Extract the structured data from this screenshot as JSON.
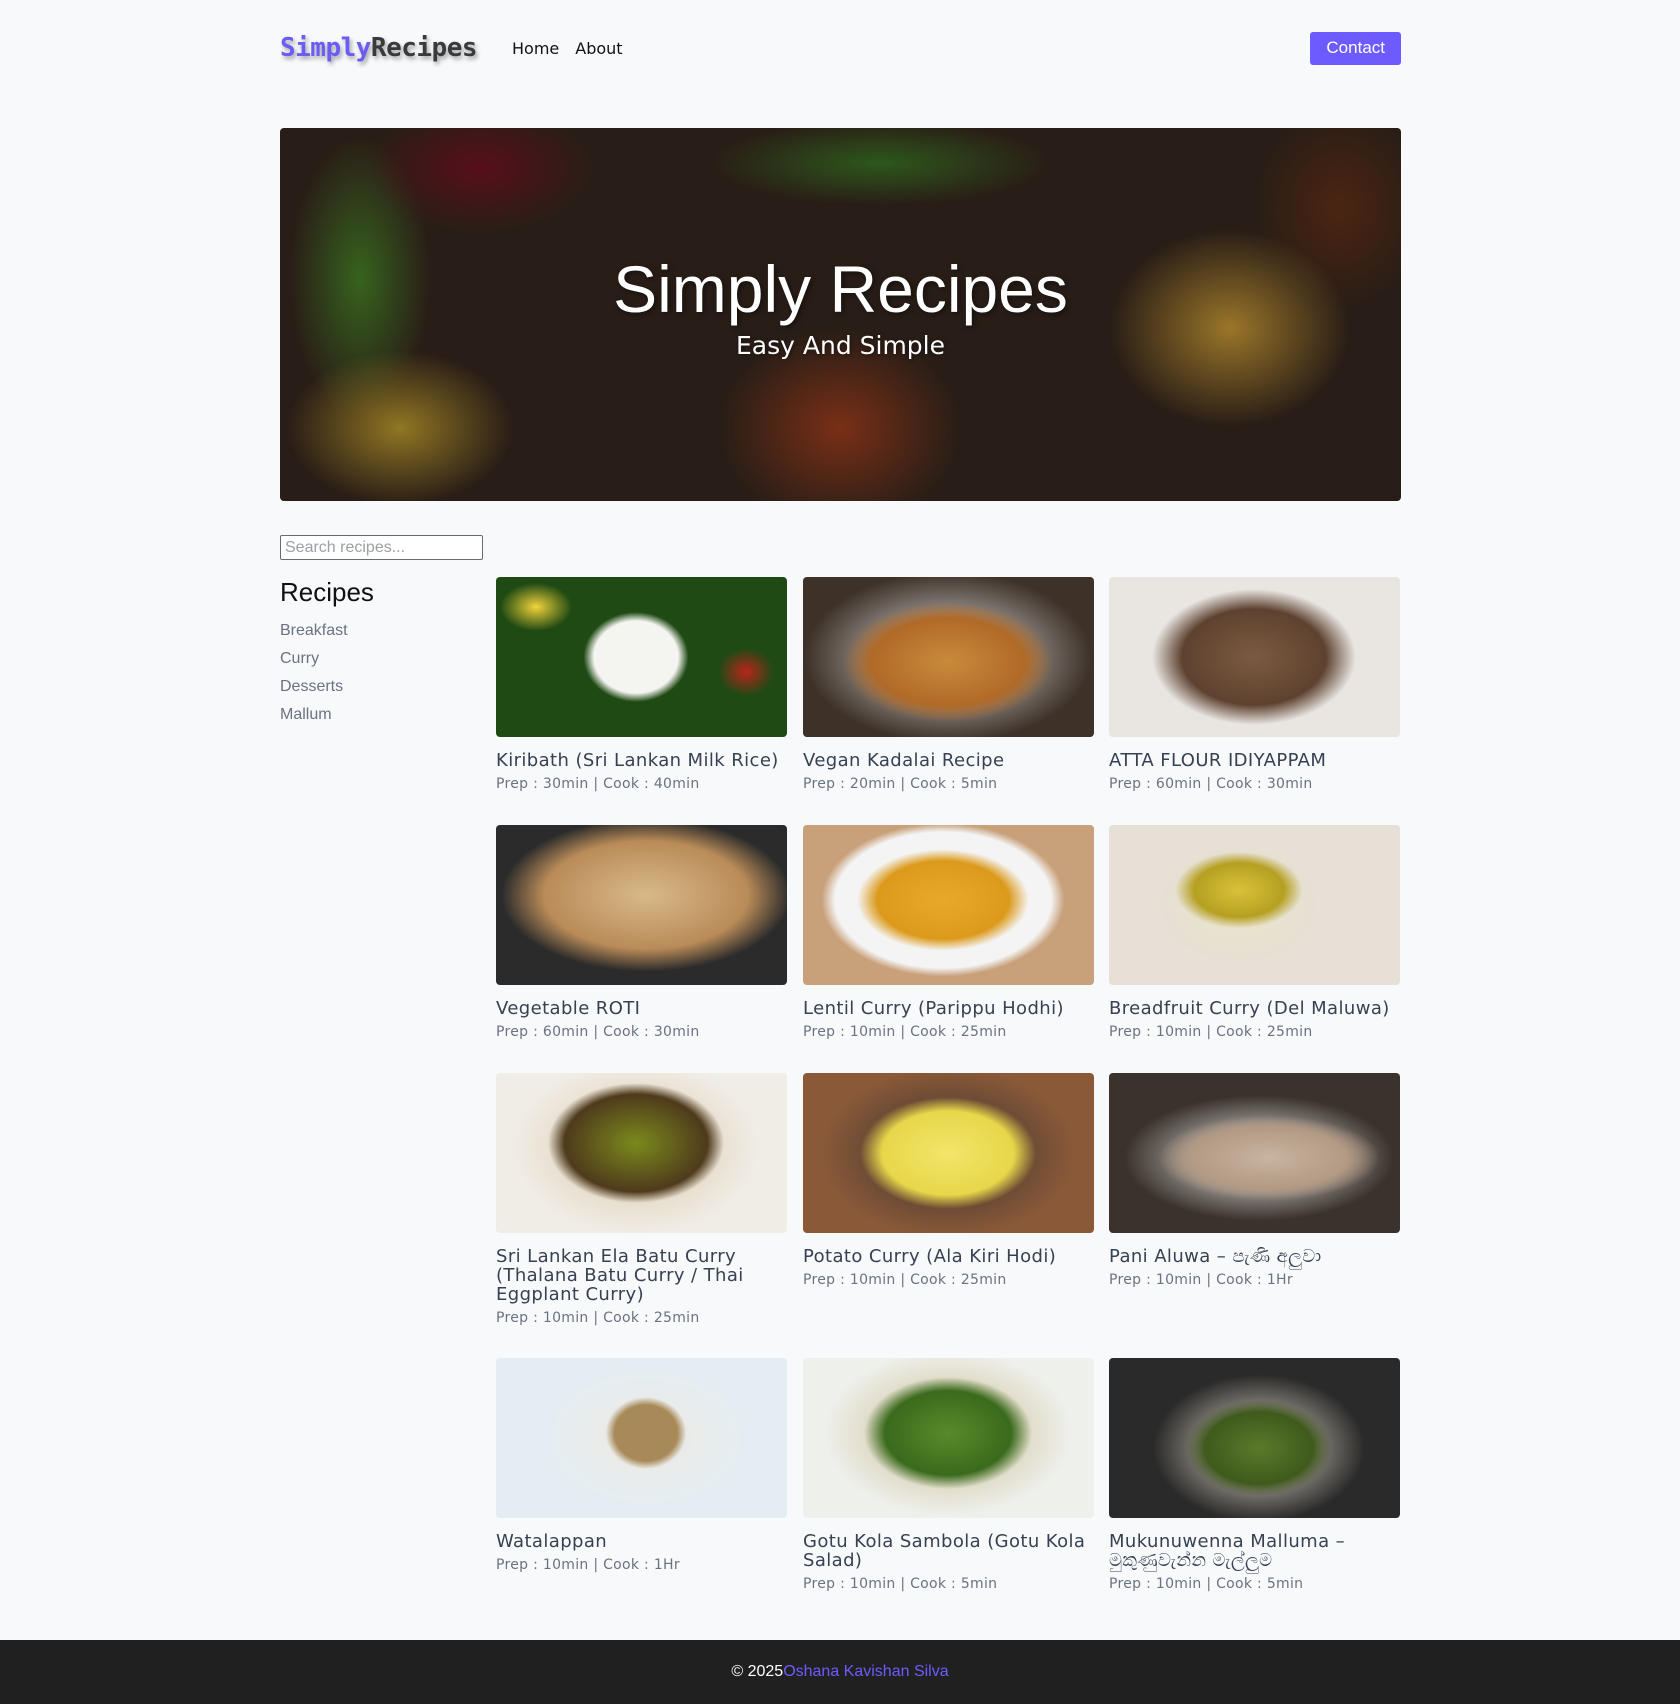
{
  "header": {
    "logo_part1": "Simply",
    "logo_part2": "Recipes",
    "nav": [
      "Home",
      "About"
    ],
    "contact_label": "Contact"
  },
  "hero": {
    "title": "Simply Recipes",
    "subtitle": "Easy And Simple"
  },
  "search": {
    "placeholder": "Search recipes..."
  },
  "sidebar": {
    "heading": "Recipes",
    "categories": [
      "Breakfast",
      "Curry",
      "Desserts",
      "Mallum"
    ]
  },
  "recipes": [
    {
      "title": "Kiribath (Sri Lankan Milk Rice)",
      "meta": "Prep : 30min | Cook : 40min"
    },
    {
      "title": "Vegan Kadalai Recipe",
      "meta": "Prep : 20min | Cook : 5min"
    },
    {
      "title": "ATTA FLOUR IDIYAPPAM",
      "meta": "Prep : 60min | Cook : 30min"
    },
    {
      "title": "Vegetable ROTI",
      "meta": "Prep : 60min | Cook : 30min"
    },
    {
      "title": "Lentil Curry (Parippu Hodhi)",
      "meta": "Prep : 10min | Cook : 25min"
    },
    {
      "title": "Breadfruit Curry (Del Maluwa)",
      "meta": "Prep : 10min | Cook : 25min"
    },
    {
      "title": "Sri Lankan Ela Batu Curry (Thalana Batu Curry / Thai Eggplant Curry)",
      "meta": "Prep : 10min | Cook : 25min"
    },
    {
      "title": "Potato Curry (Ala Kiri Hodi)",
      "meta": "Prep : 10min | Cook : 25min"
    },
    {
      "title": "Pani Aluwa – පැණි අලුවා",
      "meta": "Prep : 10min | Cook : 1Hr"
    },
    {
      "title": "Watalappan",
      "meta": "Prep : 10min | Cook : 1Hr"
    },
    {
      "title": "Gotu Kola Sambola (Gotu Kola Salad)",
      "meta": "Prep : 10min | Cook : 5min"
    },
    {
      "title": "Mukunuwenna Malluma – මුකුණුවැන්න මැල්ලුම",
      "meta": "Prep : 10min | Cook : 5min"
    }
  ],
  "footer": {
    "copyright": "© 2025",
    "author": "Oshana Kavishan Silva"
  }
}
